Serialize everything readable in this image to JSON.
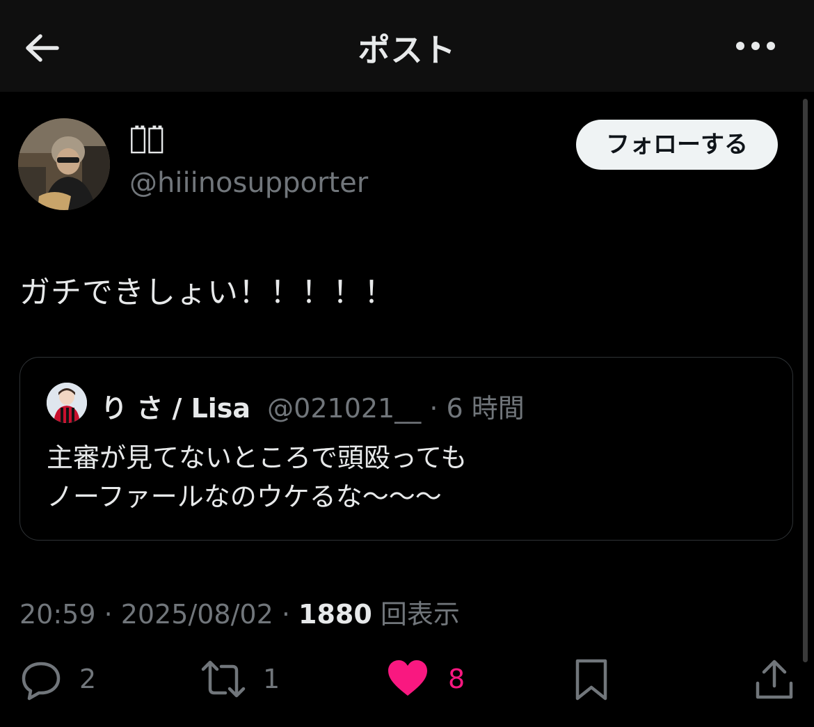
{
  "header": {
    "title": "ポスト",
    "back_icon": "arrow-left-icon",
    "more_icon": "more-horizontal-icon"
  },
  "post": {
    "author": {
      "display_name": "ひ̈ー̈",
      "handle": "@hiiinosupporter",
      "follow_label": "フォローする"
    },
    "text": "ガチできしょい！！！！！",
    "quote": {
      "name": "り さ / Lisa",
      "handle": "@021021__",
      "time": "· 6 時間",
      "text_line1": "主審が見てないところで頭殴っても",
      "text_line2": "ノーファールなのウケるな〜〜〜"
    },
    "meta": {
      "time": "20:59 · 2025/08/02 · ",
      "views_count": "1880",
      "views_label": " 回表示"
    },
    "actions": {
      "reply_count": "2",
      "repost_count": "1",
      "like_count": "8",
      "like_active": true
    }
  },
  "colors": {
    "background": "#000000",
    "header_bg": "#0f0f0f",
    "text_primary": "#e7e9ea",
    "text_secondary": "#71767b",
    "like_pink": "#f91880",
    "border": "#2f3336"
  }
}
